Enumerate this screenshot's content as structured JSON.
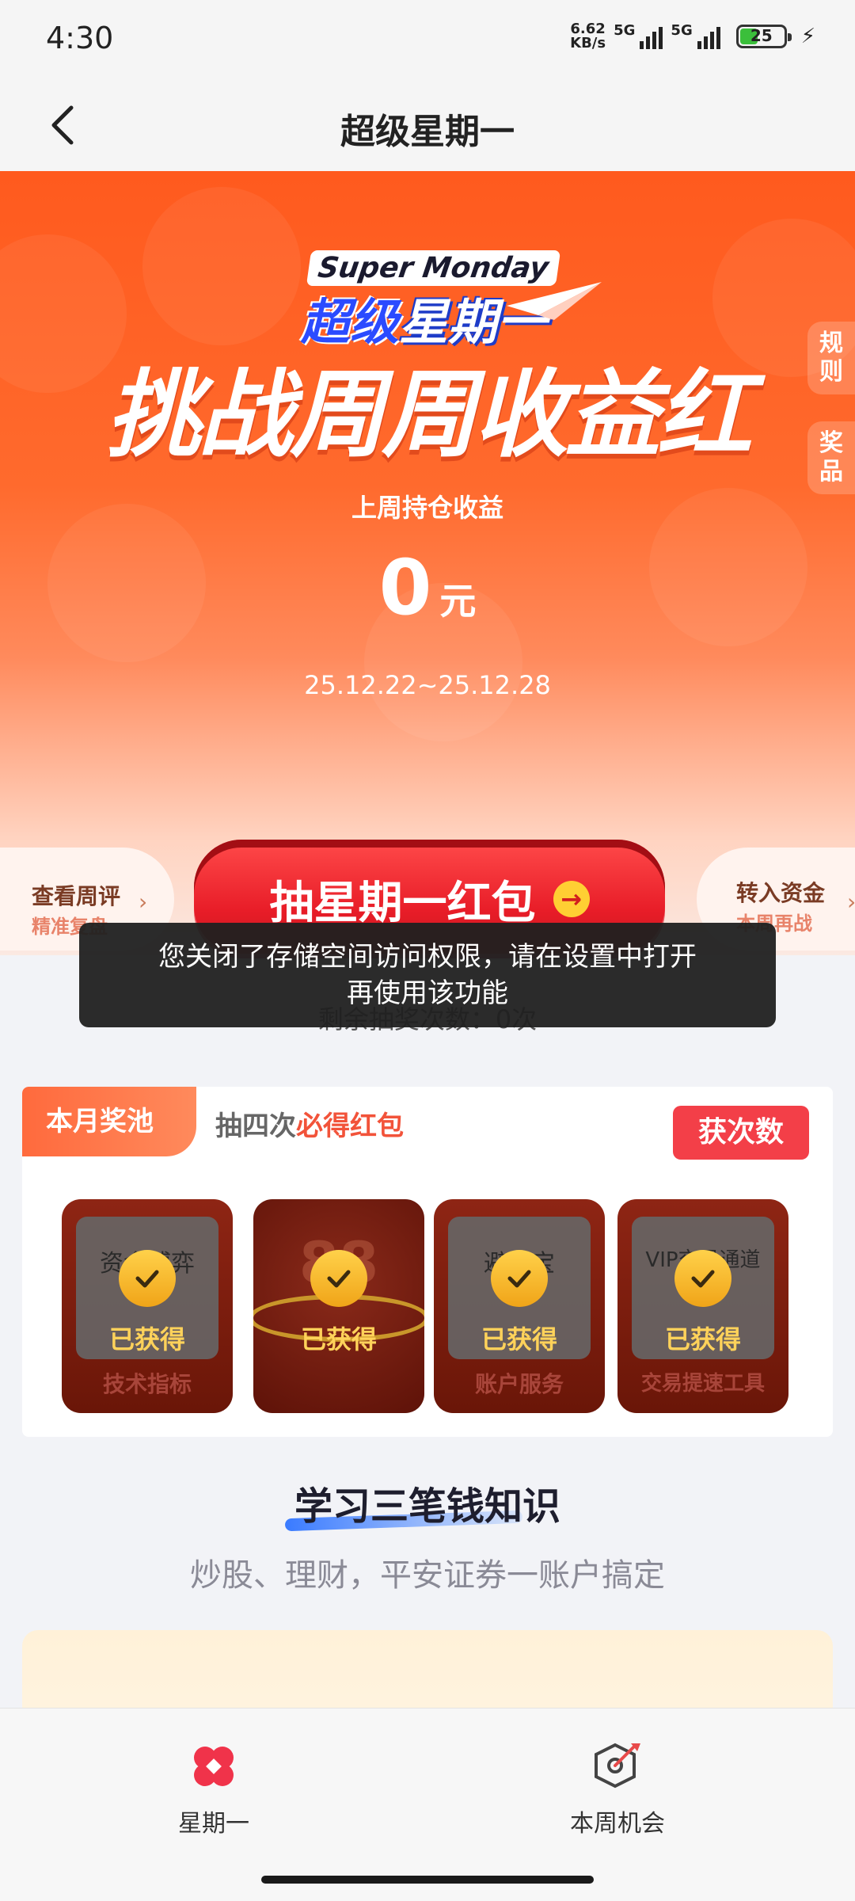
{
  "status_bar": {
    "time": "4:30",
    "net_speed_value": "6.62",
    "net_speed_unit": "KB/s",
    "sim1_label": "5G",
    "sim2_label": "5G",
    "battery": "25"
  },
  "nav": {
    "title": "超级星期一",
    "back_icon": "chevron-left-icon"
  },
  "hero": {
    "brand_en": "Super Monday",
    "brand_cn_part1": "超级",
    "brand_cn_part2": "星期一",
    "headline": "挑战周周收益红",
    "subtitle": "上周持仓收益",
    "amount": "0",
    "amount_unit": "元",
    "date_range": "25.12.22~25.12.28"
  },
  "side_tabs": {
    "rules": "规则",
    "prizes": "奖品"
  },
  "actions": {
    "left_title": "查看周评",
    "left_sub": "精准复盘",
    "draw_button": "抽星期一红包",
    "right_title": "转入资金",
    "right_sub": "本周再战"
  },
  "remaining_draws": "剩余抽奖次数：0次",
  "toast": {
    "line1": "您关闭了存储空间访问权限，请在设置中打开",
    "line2": "再使用该功能"
  },
  "prize_pool": {
    "tag": "本月奖池",
    "desc_prefix": "抽四次",
    "desc_highlight": "必得红包",
    "get_chances_button": "获次数",
    "items": [
      {
        "name": "资金博弈",
        "status": "已获得",
        "category": "技术指标"
      },
      {
        "name": "88",
        "status": "已获得",
        "category": ""
      },
      {
        "name": "避险宝",
        "status": "已获得",
        "category": "账户服务"
      },
      {
        "name": "VIP交易通道",
        "status": "已获得",
        "category": "交易提速工具"
      }
    ]
  },
  "knowledge": {
    "title": "学习三笔钱知识",
    "subtitle": "炒股、理财，平安证券一账户搞定"
  },
  "tab_bar": {
    "tabs": [
      {
        "label": "星期一",
        "icon": "clover-icon",
        "active": true
      },
      {
        "label": "本周机会",
        "icon": "target-hex-icon",
        "active": false
      }
    ]
  },
  "colors": {
    "hero_orange": "#ff5a1e",
    "draw_button_red": "#e81d28",
    "accent_red": "#f33f48",
    "highlight_orange": "#f2533a"
  }
}
